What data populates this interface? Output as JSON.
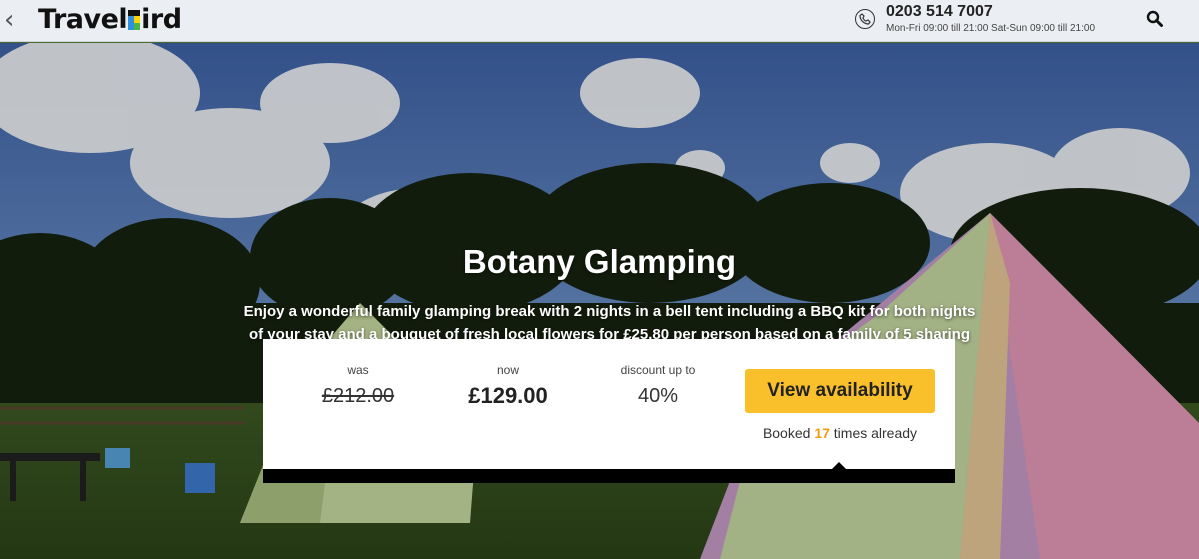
{
  "header": {
    "back_glyph": "‹",
    "logo": {
      "part1": "Travel",
      "part2": "ird",
      "flag_text": "B"
    },
    "phone_number": "0203 514 7007",
    "phone_hours": "Mon-Fri 09:00 till 21:00 Sat-Sun 09:00 till 21:00",
    "icons": {
      "back": "chevron-left-icon",
      "phone": "phone-icon",
      "search": "search-icon"
    }
  },
  "hero": {
    "title": "Botany Glamping",
    "description": "Enjoy a wonderful family glamping break with 2 nights in a bell tent including a BBQ kit for both nights of your stay and a bouquet of fresh local flowers for £25.80 per person based on a family of 5 sharing"
  },
  "offer": {
    "was_label": "was",
    "was_price": "£212.00",
    "now_label": "now",
    "now_price": "£129.00",
    "discount_label": "discount up to",
    "discount_value": "40%",
    "cta_label": "View availability",
    "booked_prefix": "Booked ",
    "booked_count": "17",
    "booked_suffix": " times already"
  },
  "colors": {
    "header_bg": "#ebeef2",
    "cta": "#f9c02c",
    "booked_count": "#f39c12"
  }
}
